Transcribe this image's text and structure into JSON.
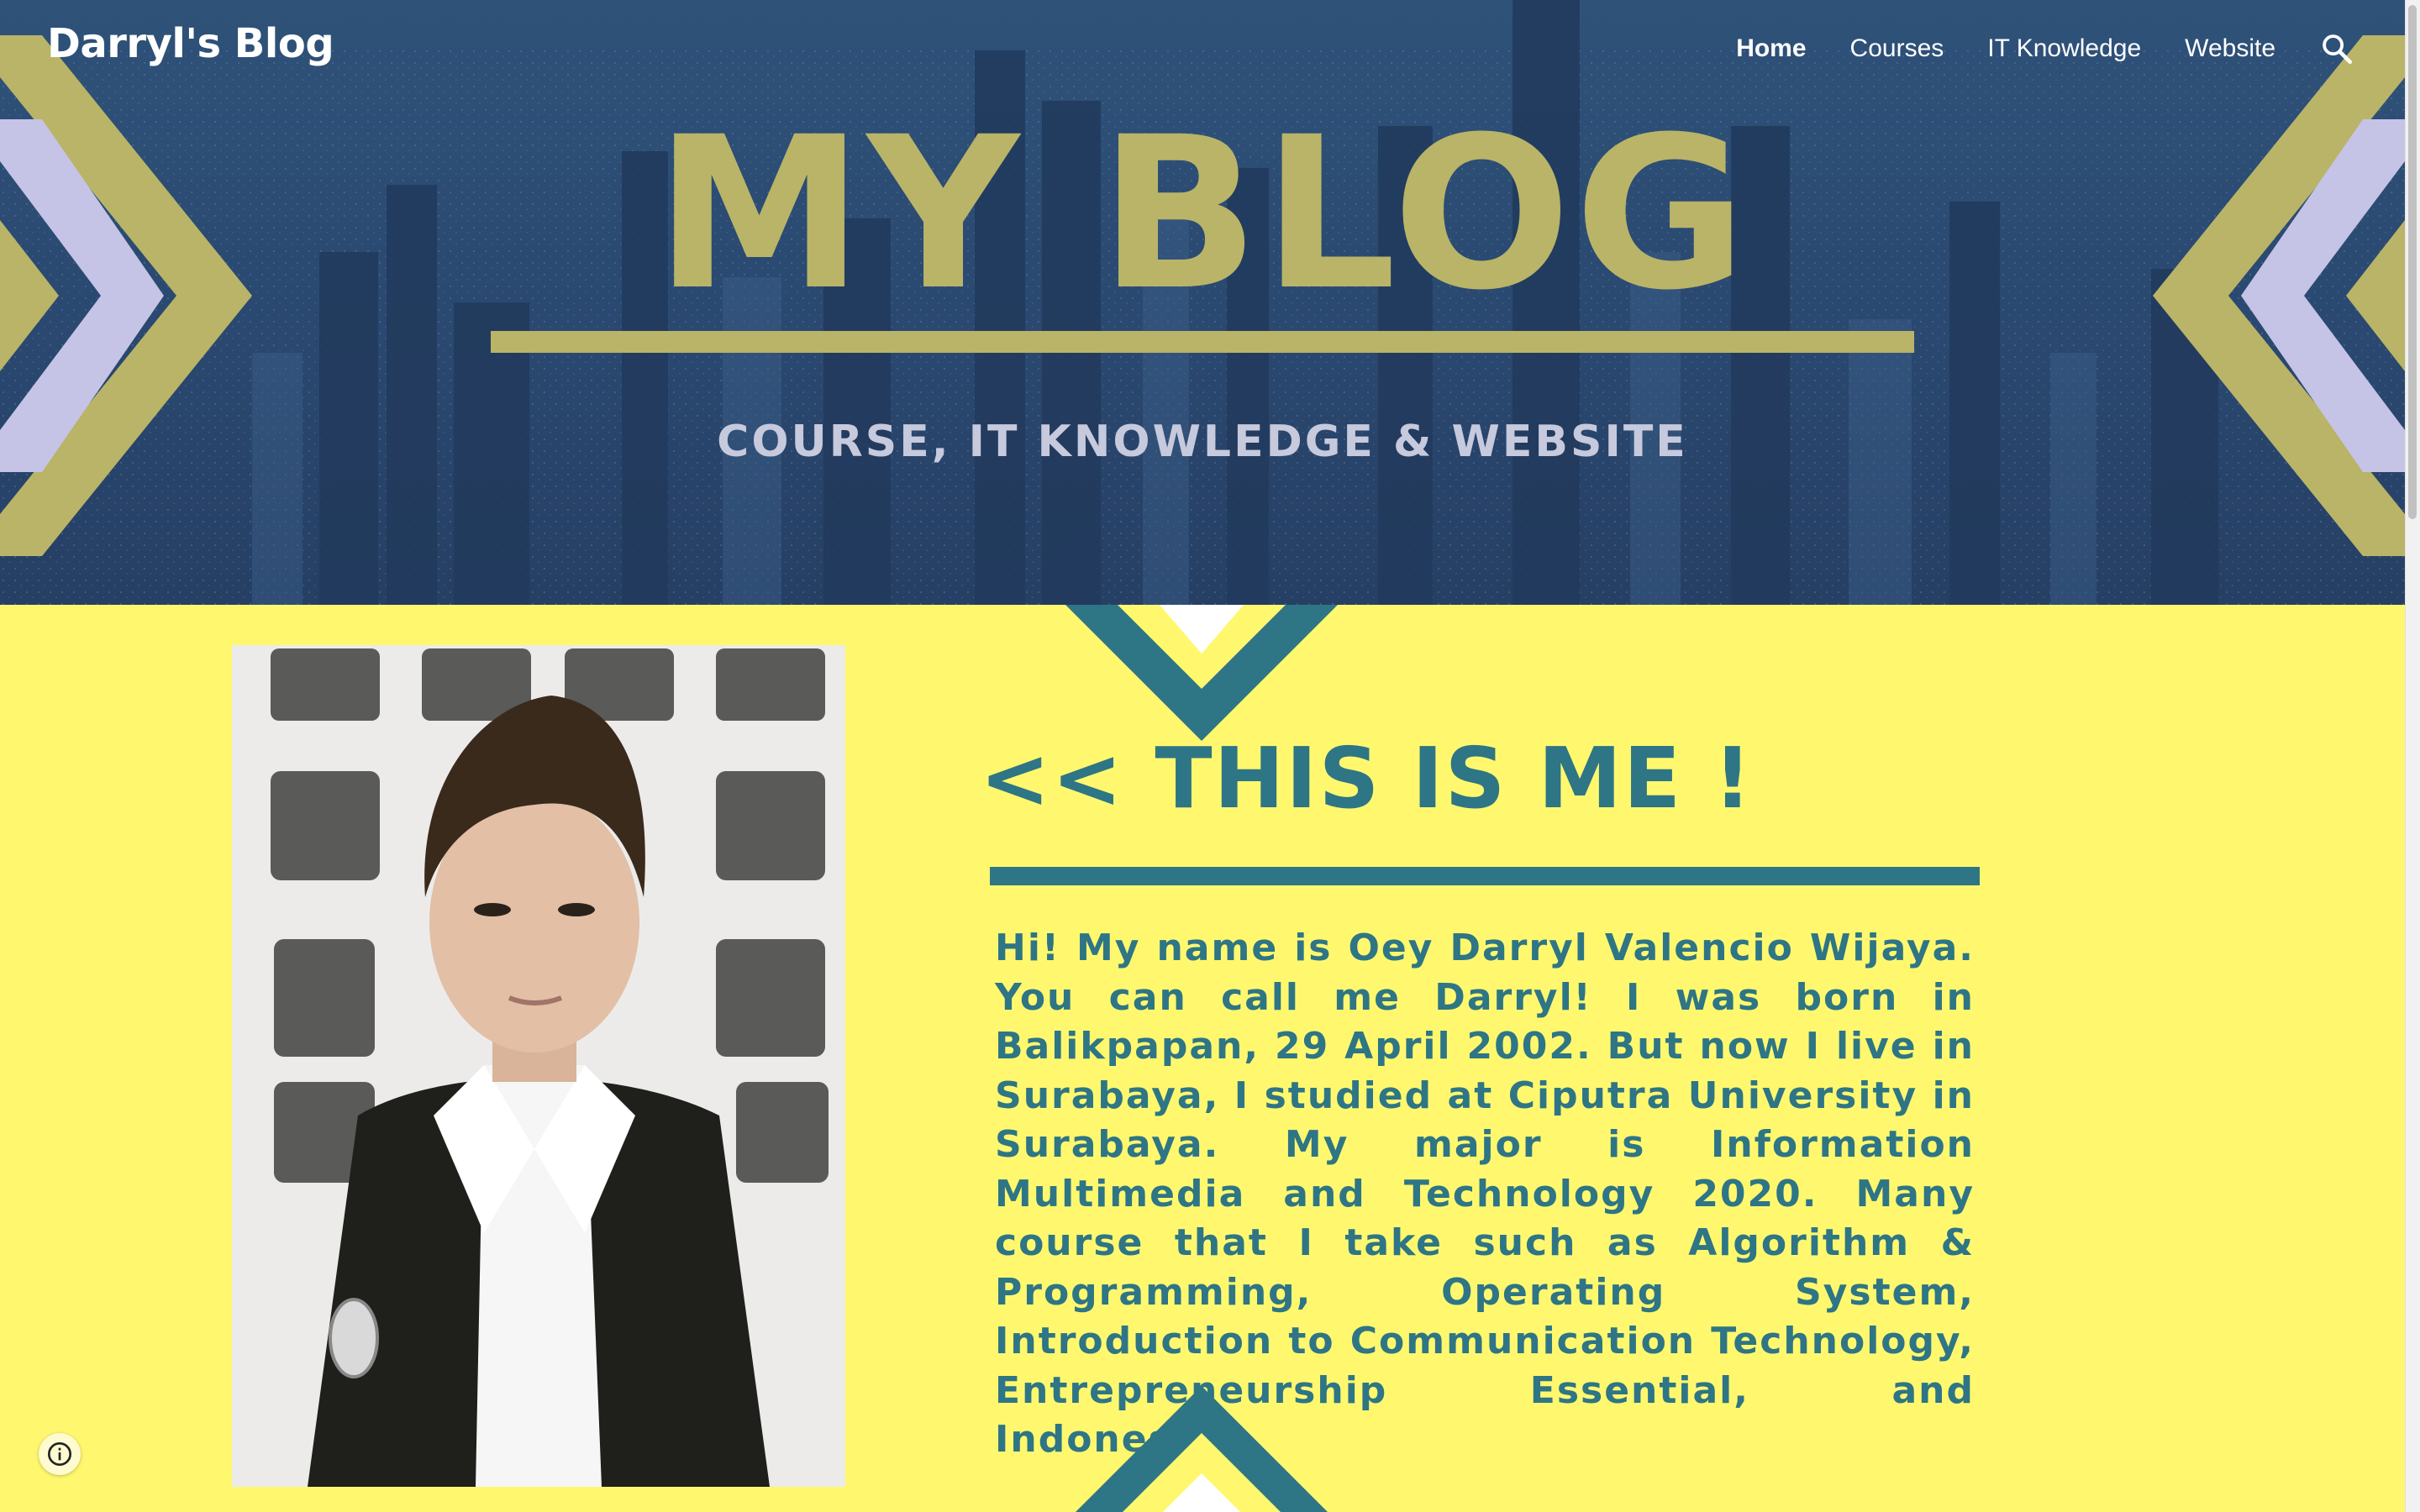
{
  "site": {
    "title": "Darryl's Blog"
  },
  "nav": {
    "items": [
      {
        "label": "Home",
        "active": true
      },
      {
        "label": "Courses",
        "active": false
      },
      {
        "label": "IT Knowledge",
        "active": false
      },
      {
        "label": "Website",
        "active": false
      }
    ],
    "search_icon": "search-icon"
  },
  "hero": {
    "heading": "MY BLOG",
    "subheading": "COURSE, IT KNOWLEDGE & WEBSITE"
  },
  "about": {
    "heading": "<< THIS IS ME !",
    "paragraph": "Hi! My name is Oey Darryl Valencio Wijaya. You can call me Darryl! I was born in Balikpapan, 29 April 2002. But now I live in Surabaya, I studied at Ciputra University in Surabaya. My major is Information Multimedia and Technology 2020. Many course that I take such as Algorithm & Programming, Operating System, Introduction to Communication Technology, Entrepreneurship Essential, and Indonesian"
  },
  "footer": {
    "info_icon": "info-icon"
  },
  "colors": {
    "hero_blue": "#2a4870",
    "gold": "#b9b467",
    "lavender": "#c5c3e6",
    "content_yellow": "#fff86f",
    "teal": "#2e7585"
  }
}
